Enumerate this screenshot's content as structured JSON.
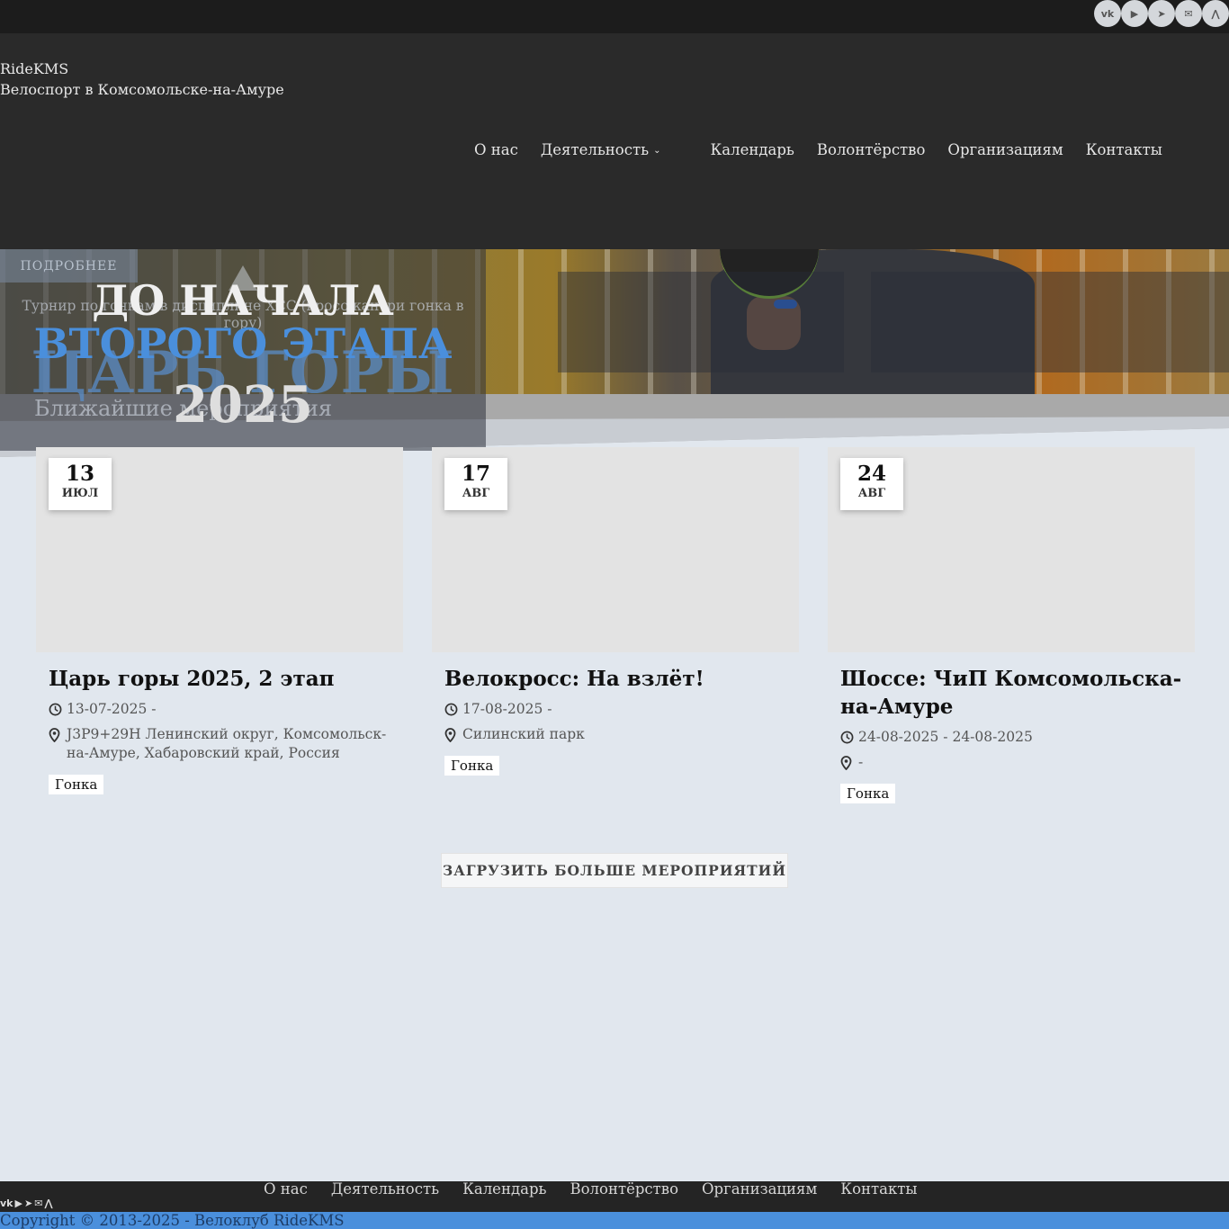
{
  "social": [
    "vk",
    "youtube",
    "telegram",
    "mail",
    "strava"
  ],
  "social_labels": {
    "vk": "vk",
    "youtube": "▶",
    "telegram": "➤",
    "mail": "✉",
    "strava": "⋀"
  },
  "brand": {
    "name": "RideKMS",
    "tagline": "Велоспорт в Комсомольске-на-Амуре"
  },
  "nav": [
    "О нас",
    "Деятельность",
    "Календарь",
    "Волонтёрство",
    "Организациям",
    "Контакты"
  ],
  "promo": {
    "button": "ПОДРОБНЕЕ",
    "line1": "ДО НАЧАЛА",
    "line2": "ВТОРОГО ЭТАПА",
    "ghost": "ЦАРЬ ГОРЫ",
    "line3": "2025",
    "description": "Турнир по гонкам в дисциплине XCC (кросс-кантри гонка в гору)",
    "nearest": "Ближайшие мероприятия"
  },
  "events": [
    {
      "day": "13",
      "month": "ИЮЛ",
      "title": "Царь горы 2025, 2 этап",
      "dates": "13-07-2025 -",
      "place": "J3P9+29H Ленинский округ, Комсомольск-на-Амуре, Хабаровский край, Россия",
      "tag": "Гонка"
    },
    {
      "day": "17",
      "month": "АВГ",
      "title": "Велокросс: На взлёт!",
      "dates": "17-08-2025 -",
      "place": "Силинский парк",
      "tag": "Гонка"
    },
    {
      "day": "24",
      "month": "АВГ",
      "title": "Шоссе: ЧиП Комсомольска-на-Амуре",
      "dates": "24-08-2025 - 24-08-2025",
      "place": "-",
      "tag": "Гонка"
    }
  ],
  "load_more": "ЗАГРУЗИТЬ БОЛЬШЕ МЕРОПРИЯТИЙ",
  "footer_nav": [
    "О нас",
    "Деятельность",
    "Календарь",
    "Волонтёрство",
    "Организациям",
    "Контакты"
  ],
  "copyright": "Copyright © 2013-2025 - Велоклуб RideKMS",
  "colors": {
    "accent": "#4a8fdc",
    "header_bg": "#2a2a2a",
    "page_bg": "#e1e7ee"
  }
}
